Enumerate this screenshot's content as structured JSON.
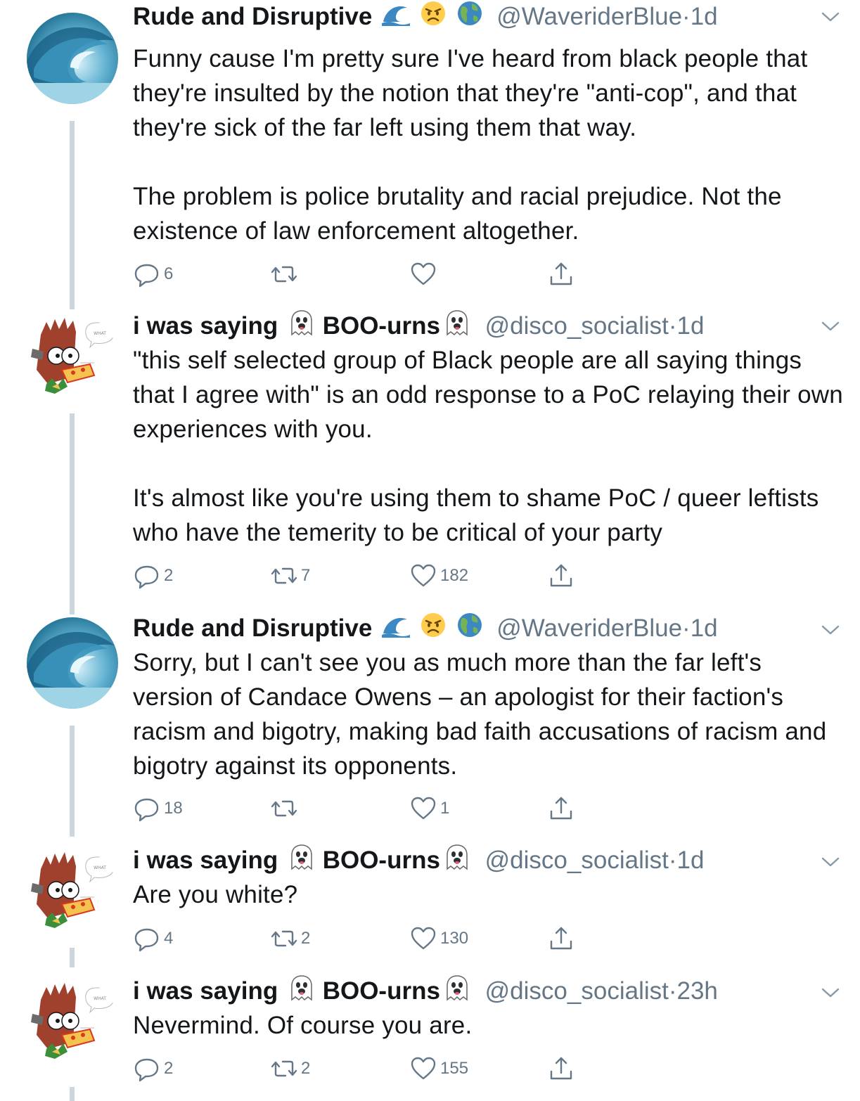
{
  "tweets": [
    {
      "name": "Rude and Disruptive",
      "emojis": [
        "wave-emoji",
        "angry-face-emoji",
        "globe-emoji"
      ],
      "handle": "@WaveriderBlue",
      "dot": "·",
      "time": "1d",
      "paragraphs": [
        "Funny cause I'm pretty sure I've heard from black people that they're insulted by the notion that they're \"anti-cop\", and that they're sick of the far left using them that way.",
        "The problem is police brutality and racial prejudice. Not the existence of law enforcement altogether."
      ],
      "replies": "6",
      "retweets": "",
      "likes": ""
    },
    {
      "name": "i was saying",
      "name2": "BOO-urns",
      "emojis": [
        "ghost-emoji",
        "ghost-emoji"
      ],
      "handle": "@disco_socialist",
      "dot": "·",
      "time": "1d",
      "paragraphs": [
        "\"this self selected group of Black people are all saying things that I agree with\" is an odd response to a PoC relaying their own experiences with you.",
        "It's almost like you're using them to shame PoC / queer leftists who have the temerity to be critical of your party"
      ],
      "replies": "2",
      "retweets": "7",
      "likes": "182"
    },
    {
      "name": "Rude and Disruptive",
      "emojis": [
        "wave-emoji",
        "angry-face-emoji",
        "globe-emoji"
      ],
      "handle": "@WaveriderBlue",
      "dot": "·",
      "time": "1d",
      "paragraphs": [
        "Sorry, but I can't see you as much more than the far left's version of Candace Owens – an apologist for their faction's racism and bigotry, making bad faith accusations of racism and bigotry against its opponents."
      ],
      "replies": "18",
      "retweets": "",
      "likes": "1"
    },
    {
      "name": "i was saying",
      "name2": "BOO-urns",
      "emojis": [
        "ghost-emoji",
        "ghost-emoji"
      ],
      "handle": "@disco_socialist",
      "dot": "·",
      "time": "1d",
      "paragraphs": [
        "Are you white?"
      ],
      "replies": "4",
      "retweets": "2",
      "likes": "130"
    },
    {
      "name": "i was saying",
      "name2": "BOO-urns",
      "emojis": [
        "ghost-emoji",
        "ghost-emoji"
      ],
      "handle": "@disco_socialist",
      "dot": "·",
      "time": "23h",
      "paragraphs": [
        "Nevermind. Of course you are."
      ],
      "replies": "2",
      "retweets": "2",
      "likes": "155"
    }
  ],
  "avatar_text": "WHAT",
  "colors": {
    "text": "#14171a",
    "muted": "#657786",
    "thread_line": "#cdd6dd"
  }
}
